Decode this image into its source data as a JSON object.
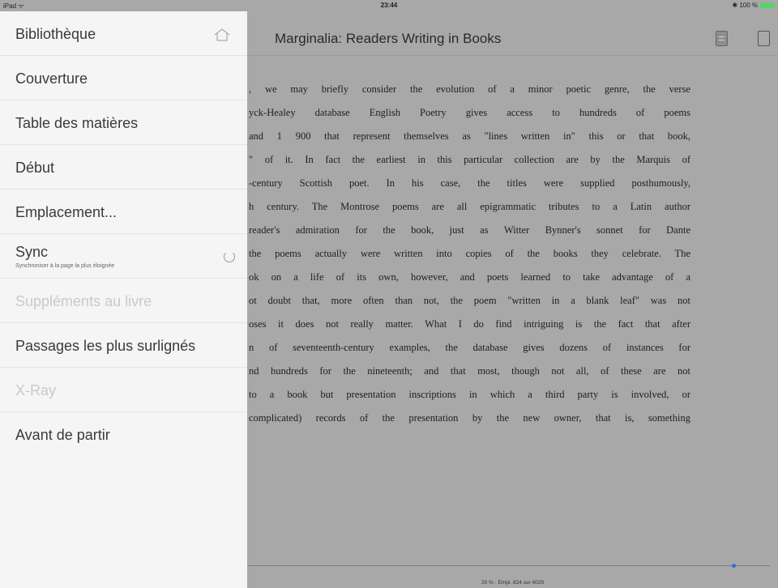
{
  "status_bar": {
    "device": "iPad ᯤ",
    "time": "23:44",
    "battery": "✱ 100 %"
  },
  "book": {
    "title": "Marginalia: Readers Writing in Books",
    "lines": [
      ", we may briefly consider the evolution of a minor poetic genre, the verse",
      "yck-Healey database English Poetry gives access to hundreds of poems",
      "and 1 900 that represent themselves as \"lines written in\" this or that book,",
      "\" of it. In fact the earliest in this particular collection are by the Marquis of",
      "-century Scottish poet. In his case, the titles were supplied posthumously,",
      "h century. The Montrose poems are all epigrammatic tributes to a Latin author",
      "reader's admiration for the book, just as Witter Bynner's sonnet for Dante",
      "the poems actually were written into copies of the books they celebrate. The",
      "ok on a life of its own, however, and poets learned to take advantage of a",
      "ot doubt that, more often than not, the poem \"written in a blank leaf\" was not",
      "oses it does not really matter. What I do find intriguing is the fact that after",
      "n of seventeenth-century examples, the database gives dozens of instances for",
      "nd hundreds for the nineteenth; and that most, though not all, of these are not",
      "to a book but presentation inscriptions in which a third party is involved, or",
      "complicated) records of the presentation by the new owner, that is, something"
    ],
    "progress_fraction": 0.93,
    "footer": "20 % · Empl. 824 sur 4029"
  },
  "menu": {
    "library": "Bibliothèque",
    "cover": "Couverture",
    "toc": "Table des matières",
    "start": "Début",
    "location": "Emplacement...",
    "sync": "Sync",
    "sync_sub": "Synchroniser à la page la plus éloignée",
    "extras": "Suppléments au livre",
    "highlights": "Passages les plus surlignés",
    "xray": "X-Ray",
    "before_you_go": "Avant de partir"
  },
  "colors": {
    "accent": "#2f6fd6",
    "battery": "#4cd964"
  }
}
